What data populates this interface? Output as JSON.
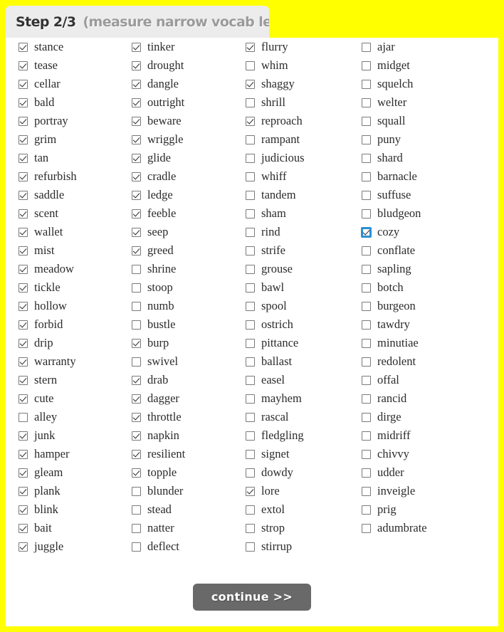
{
  "header": {
    "step_label": "Step 2/3",
    "step_sub": "(measure narrow vocab level)"
  },
  "colors": {
    "page_background": "#ffff00",
    "card_background": "#ffffff",
    "header_tab": "#ececec",
    "step_label_color": "#333333",
    "step_sub_color": "#9b9b9b",
    "button_background": "#696969",
    "button_text": "#ffffff",
    "focus_outline": "#2b8fd4",
    "checkbox_border": "#7a7a7a",
    "word_text": "#2b2b2b"
  },
  "footer": {
    "continue_label": "continue >>"
  },
  "columns": [
    {
      "id": "column-1",
      "items": [
        {
          "label": "stance",
          "checked": true,
          "focused": false
        },
        {
          "label": "tease",
          "checked": true,
          "focused": false
        },
        {
          "label": "cellar",
          "checked": true,
          "focused": false
        },
        {
          "label": "bald",
          "checked": true,
          "focused": false
        },
        {
          "label": "portray",
          "checked": true,
          "focused": false
        },
        {
          "label": "grim",
          "checked": true,
          "focused": false
        },
        {
          "label": "tan",
          "checked": true,
          "focused": false
        },
        {
          "label": "refurbish",
          "checked": true,
          "focused": false
        },
        {
          "label": "saddle",
          "checked": true,
          "focused": false
        },
        {
          "label": "scent",
          "checked": true,
          "focused": false
        },
        {
          "label": "wallet",
          "checked": true,
          "focused": false
        },
        {
          "label": "mist",
          "checked": true,
          "focused": false
        },
        {
          "label": "meadow",
          "checked": true,
          "focused": false
        },
        {
          "label": "tickle",
          "checked": true,
          "focused": false
        },
        {
          "label": "hollow",
          "checked": true,
          "focused": false
        },
        {
          "label": "forbid",
          "checked": true,
          "focused": false
        },
        {
          "label": "drip",
          "checked": true,
          "focused": false
        },
        {
          "label": "warranty",
          "checked": true,
          "focused": false
        },
        {
          "label": "stern",
          "checked": true,
          "focused": false
        },
        {
          "label": "cute",
          "checked": true,
          "focused": false
        },
        {
          "label": "alley",
          "checked": false,
          "focused": false
        },
        {
          "label": "junk",
          "checked": true,
          "focused": false
        },
        {
          "label": "hamper",
          "checked": true,
          "focused": false
        },
        {
          "label": "gleam",
          "checked": true,
          "focused": false
        },
        {
          "label": "plank",
          "checked": true,
          "focused": false
        },
        {
          "label": "blink",
          "checked": true,
          "focused": false
        },
        {
          "label": "bait",
          "checked": true,
          "focused": false
        },
        {
          "label": "juggle",
          "checked": true,
          "focused": false
        }
      ]
    },
    {
      "id": "column-2",
      "items": [
        {
          "label": "tinker",
          "checked": true,
          "focused": false
        },
        {
          "label": "drought",
          "checked": true,
          "focused": false
        },
        {
          "label": "dangle",
          "checked": true,
          "focused": false
        },
        {
          "label": "outright",
          "checked": true,
          "focused": false
        },
        {
          "label": "beware",
          "checked": true,
          "focused": false
        },
        {
          "label": "wriggle",
          "checked": true,
          "focused": false
        },
        {
          "label": "glide",
          "checked": true,
          "focused": false
        },
        {
          "label": "cradle",
          "checked": true,
          "focused": false
        },
        {
          "label": "ledge",
          "checked": true,
          "focused": false
        },
        {
          "label": "feeble",
          "checked": true,
          "focused": false
        },
        {
          "label": "seep",
          "checked": true,
          "focused": false
        },
        {
          "label": "greed",
          "checked": true,
          "focused": false
        },
        {
          "label": "shrine",
          "checked": false,
          "focused": false
        },
        {
          "label": "stoop",
          "checked": false,
          "focused": false
        },
        {
          "label": "numb",
          "checked": false,
          "focused": false
        },
        {
          "label": "bustle",
          "checked": false,
          "focused": false
        },
        {
          "label": "burp",
          "checked": true,
          "focused": false
        },
        {
          "label": "swivel",
          "checked": false,
          "focused": false
        },
        {
          "label": "drab",
          "checked": true,
          "focused": false
        },
        {
          "label": "dagger",
          "checked": true,
          "focused": false
        },
        {
          "label": "throttle",
          "checked": true,
          "focused": false
        },
        {
          "label": "napkin",
          "checked": true,
          "focused": false
        },
        {
          "label": "resilient",
          "checked": true,
          "focused": false
        },
        {
          "label": "topple",
          "checked": true,
          "focused": false
        },
        {
          "label": "blunder",
          "checked": false,
          "focused": false
        },
        {
          "label": "stead",
          "checked": false,
          "focused": false
        },
        {
          "label": "natter",
          "checked": false,
          "focused": false
        },
        {
          "label": "deflect",
          "checked": false,
          "focused": false
        }
      ]
    },
    {
      "id": "column-3",
      "items": [
        {
          "label": "flurry",
          "checked": true,
          "focused": false
        },
        {
          "label": "whim",
          "checked": false,
          "focused": false
        },
        {
          "label": "shaggy",
          "checked": true,
          "focused": false
        },
        {
          "label": "shrill",
          "checked": false,
          "focused": false
        },
        {
          "label": "reproach",
          "checked": true,
          "focused": false
        },
        {
          "label": "rampant",
          "checked": false,
          "focused": false
        },
        {
          "label": "judicious",
          "checked": false,
          "focused": false
        },
        {
          "label": "whiff",
          "checked": false,
          "focused": false
        },
        {
          "label": "tandem",
          "checked": false,
          "focused": false
        },
        {
          "label": "sham",
          "checked": false,
          "focused": false
        },
        {
          "label": "rind",
          "checked": false,
          "focused": false
        },
        {
          "label": "strife",
          "checked": false,
          "focused": false
        },
        {
          "label": "grouse",
          "checked": false,
          "focused": false
        },
        {
          "label": "bawl",
          "checked": false,
          "focused": false
        },
        {
          "label": "spool",
          "checked": false,
          "focused": false
        },
        {
          "label": "ostrich",
          "checked": false,
          "focused": false
        },
        {
          "label": "pittance",
          "checked": false,
          "focused": false
        },
        {
          "label": "ballast",
          "checked": false,
          "focused": false
        },
        {
          "label": "easel",
          "checked": false,
          "focused": false
        },
        {
          "label": "mayhem",
          "checked": false,
          "focused": false
        },
        {
          "label": "rascal",
          "checked": false,
          "focused": false
        },
        {
          "label": "fledgling",
          "checked": false,
          "focused": false
        },
        {
          "label": "signet",
          "checked": false,
          "focused": false
        },
        {
          "label": "dowdy",
          "checked": false,
          "focused": false
        },
        {
          "label": "lore",
          "checked": true,
          "focused": false
        },
        {
          "label": "extol",
          "checked": false,
          "focused": false
        },
        {
          "label": "strop",
          "checked": false,
          "focused": false
        },
        {
          "label": "stirrup",
          "checked": false,
          "focused": false
        }
      ]
    },
    {
      "id": "column-4",
      "items": [
        {
          "label": "ajar",
          "checked": false,
          "focused": false
        },
        {
          "label": "midget",
          "checked": false,
          "focused": false
        },
        {
          "label": "squelch",
          "checked": false,
          "focused": false
        },
        {
          "label": "welter",
          "checked": false,
          "focused": false
        },
        {
          "label": "squall",
          "checked": false,
          "focused": false
        },
        {
          "label": "puny",
          "checked": false,
          "focused": false
        },
        {
          "label": "shard",
          "checked": false,
          "focused": false
        },
        {
          "label": "barnacle",
          "checked": false,
          "focused": false
        },
        {
          "label": "suffuse",
          "checked": false,
          "focused": false
        },
        {
          "label": "bludgeon",
          "checked": false,
          "focused": false
        },
        {
          "label": "cozy",
          "checked": true,
          "focused": true
        },
        {
          "label": "conflate",
          "checked": false,
          "focused": false
        },
        {
          "label": "sapling",
          "checked": false,
          "focused": false
        },
        {
          "label": "botch",
          "checked": false,
          "focused": false
        },
        {
          "label": "burgeon",
          "checked": false,
          "focused": false
        },
        {
          "label": "tawdry",
          "checked": false,
          "focused": false
        },
        {
          "label": "minutiae",
          "checked": false,
          "focused": false
        },
        {
          "label": "redolent",
          "checked": false,
          "focused": false
        },
        {
          "label": "offal",
          "checked": false,
          "focused": false
        },
        {
          "label": "rancid",
          "checked": false,
          "focused": false
        },
        {
          "label": "dirge",
          "checked": false,
          "focused": false
        },
        {
          "label": "midriff",
          "checked": false,
          "focused": false
        },
        {
          "label": "chivvy",
          "checked": false,
          "focused": false
        },
        {
          "label": "udder",
          "checked": false,
          "focused": false
        },
        {
          "label": "inveigle",
          "checked": false,
          "focused": false
        },
        {
          "label": "prig",
          "checked": false,
          "focused": false
        },
        {
          "label": "adumbrate",
          "checked": false,
          "focused": false
        }
      ]
    }
  ]
}
